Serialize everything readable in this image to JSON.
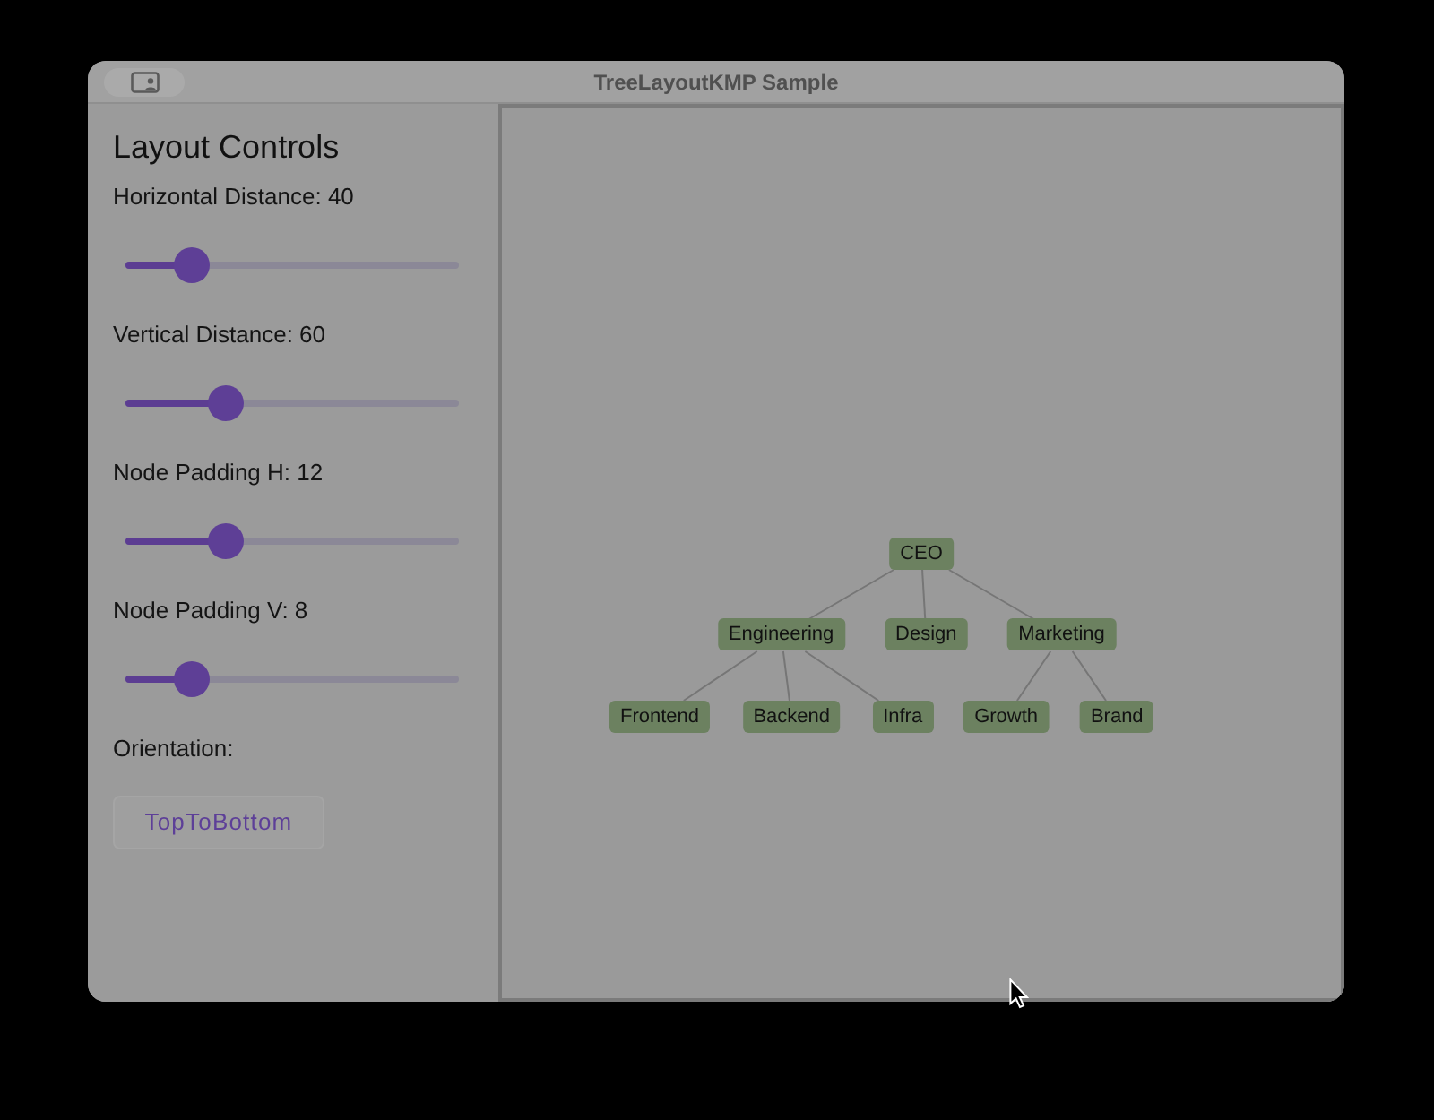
{
  "window": {
    "title": "TreeLayoutKMP Sample"
  },
  "sidebar": {
    "title": "Layout Controls",
    "sliders": [
      {
        "label": "Horizontal Distance: 40",
        "level": 0.2
      },
      {
        "label": "Vertical Distance: 60",
        "level": 0.3
      },
      {
        "label": "Node Padding H: 12",
        "level": 0.3
      },
      {
        "label": "Node Padding V: 8",
        "level": 0.2
      }
    ],
    "orientation_label": "Orientation:",
    "orientation_button": "TopToBottom"
  },
  "tree": {
    "label": "CEO",
    "children": [
      {
        "label": "Engineering",
        "children": [
          {
            "label": "Frontend"
          },
          {
            "label": "Backend"
          },
          {
            "label": "Infra"
          }
        ]
      },
      {
        "label": "Design"
      },
      {
        "label": "Marketing",
        "children": [
          {
            "label": "Growth"
          },
          {
            "label": "Brand"
          }
        ]
      }
    ]
  }
}
